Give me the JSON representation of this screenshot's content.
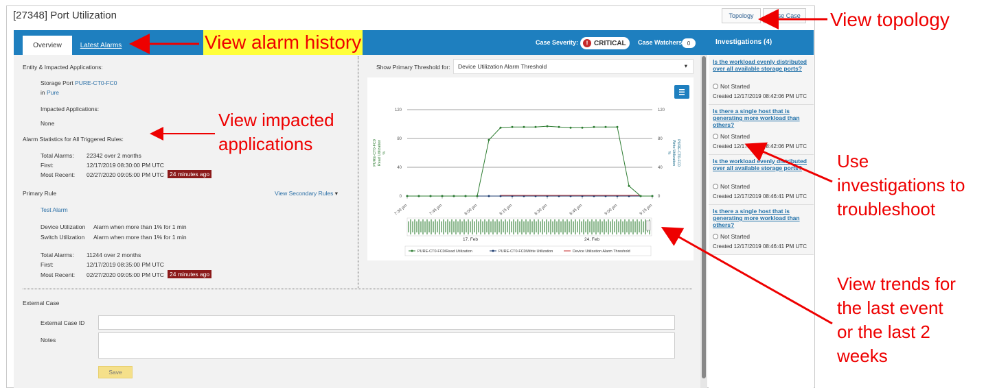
{
  "header": {
    "title": "[27348] Port Utilization",
    "topology_label": "Topology",
    "close_label": "Close Case"
  },
  "tabs": [
    {
      "label": "Overview"
    },
    {
      "label": "Latest Alarms"
    }
  ],
  "case": {
    "severity_label": "Case Severity:",
    "severity_value": "CRITICAL",
    "watchers_label": "Case Watchers",
    "watchers_count": "0"
  },
  "entity": {
    "heading": "Entity & Impacted Applications:",
    "port_prefix": "Storage Port",
    "port_name": "PURE-CT0-FC0",
    "in_prefix": "in",
    "in_name": "Pure",
    "impacted_heading": "Impacted Applications:",
    "impacted_value": "None"
  },
  "stats": {
    "heading": "Alarm Statistics for All Triggered Rules:",
    "total_label": "Total Alarms:",
    "total_value": "22342 over 2 months",
    "first_label": "First:",
    "first_value": "12/17/2019 08:30:00 PM UTC",
    "recent_label": "Most Recent:",
    "recent_value": "02/27/2020 09:05:00 PM UTC",
    "recent_ago": "24 minutes ago"
  },
  "rule": {
    "heading": "Primary Rule",
    "secondary_link": "View Secondary Rules",
    "name": "Test Alarm",
    "dev_label": "Device Utilization",
    "dev_value": "Alarm when more than 1% for 1 min",
    "sw_label": "Switch Utilization",
    "sw_value": "Alarm when more than 1% for 1 min",
    "total_label": "Total Alarms:",
    "total_value": "11244 over 2 months",
    "first_label": "First:",
    "first_value": "12/17/2019 08:35:00 PM UTC",
    "recent_label": "Most Recent:",
    "recent_value": "02/27/2020 09:05:00 PM UTC",
    "recent_ago": "24 minutes ago"
  },
  "threshold": {
    "label": "Show Primary Threshold for:",
    "value": "Device Utilization Alarm Threshold"
  },
  "chart_data": {
    "type": "line",
    "x": [
      "7:30 pm",
      "7:35",
      "7:40",
      "7:45",
      "7:50",
      "7:55",
      "8:00",
      "8:05",
      "8:10",
      "8:15",
      "8:20",
      "8:25",
      "8:30",
      "8:35",
      "8:40",
      "8:45",
      "8:50",
      "8:55",
      "9:00",
      "9:05",
      "9:10",
      "9:15"
    ],
    "xticks": [
      "7:30 pm",
      "7:45 pm",
      "8:00 pm",
      "8:15 pm",
      "8:30 pm",
      "8:45 pm",
      "9:00 pm",
      "9:15 pm"
    ],
    "yticks": [
      "0",
      "40",
      "80",
      "120"
    ],
    "ylim": [
      0,
      120
    ],
    "ylabel_left": [
      "PURE-CT0-FC0",
      "Read Utilization",
      "%"
    ],
    "ylabel_right": [
      "PURE-CT0-FC0",
      "Write Utilization",
      "%"
    ],
    "series": [
      {
        "name": "PURE-CT0-FC0/Read Utilization",
        "color": "#2e7d32",
        "values": [
          0,
          0,
          0,
          0,
          0,
          0,
          0,
          78,
          95,
          96,
          96,
          96,
          97,
          96,
          95,
          95,
          96,
          96,
          96,
          14,
          0,
          0
        ]
      },
      {
        "name": "PURE-CT0-FC0/Write Utilization",
        "color": "#1a3a6e",
        "values": [
          0,
          0,
          0,
          0,
          0,
          0,
          0,
          0,
          0,
          0,
          0,
          0,
          0,
          0,
          0,
          0,
          0,
          0,
          0,
          0,
          0,
          0
        ]
      },
      {
        "name": "Device Utilization Alarm Threshold",
        "color": "#c62828",
        "values": [
          null,
          null,
          null,
          null,
          null,
          null,
          null,
          null,
          1,
          1,
          1,
          1,
          1,
          1,
          1,
          1,
          1,
          1,
          1,
          1,
          1,
          null
        ]
      }
    ],
    "navigator_labels": [
      "17. Feb",
      "24. Feb"
    ]
  },
  "external": {
    "heading": "External Case",
    "id_label": "External Case ID",
    "notes_label": "Notes",
    "save_label": "Save"
  },
  "investigations": {
    "title": "Investigations (4)",
    "items": [
      {
        "question": "Is the workload evenly distributed over all available storage ports?",
        "status": "Not Started",
        "created": "Created 12/17/2019 08:42:06 PM UTC"
      },
      {
        "question": "Is there a single host that is generating more workload than others?",
        "status": "Not Started",
        "created": "Created 12/17/2019 08:42:06 PM UTC"
      },
      {
        "question": "Is the workload evenly distributed over all available storage ports?",
        "status": "Not Started",
        "created": "Created 12/17/2019 08:46:41 PM UTC"
      },
      {
        "question": "Is there a single host that is generating more workload than others?",
        "status": "Not Started",
        "created": "Created 12/17/2019 08:46:41 PM UTC"
      }
    ]
  },
  "annotations": {
    "alarm_history": "View alarm history",
    "topology": "View topology",
    "impacted_1": "View impacted",
    "impacted_2": "applications",
    "inv_1": "Use",
    "inv_2": "investigations to",
    "inv_3": "troubleshoot",
    "trend_1": "View trends for",
    "trend_2": "the last event",
    "trend_3": "or the last 2",
    "trend_4": "weeks"
  }
}
